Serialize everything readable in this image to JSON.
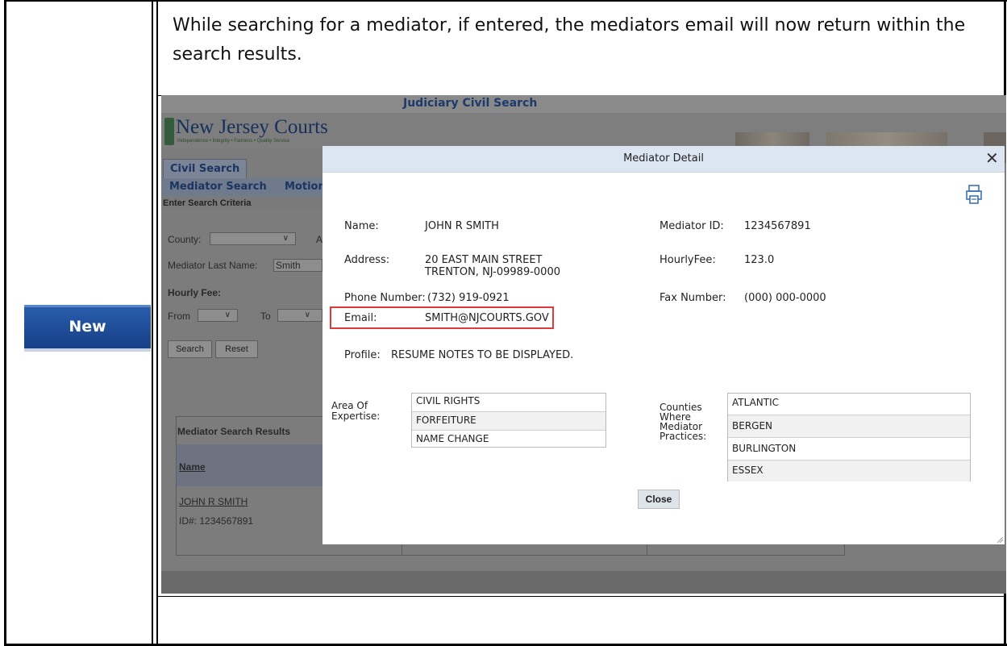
{
  "badge": "New",
  "description": "While searching for a mediator, if entered, the mediators email will now return within the search results.",
  "app": {
    "title": "Judiciary Civil Search",
    "logo_text": "New Jersey Courts",
    "logo_tagline": "Independence • Integrity • Fairness • Quality Service",
    "tab_civil": "Civil Search",
    "subtab_mediator": "Mediator Search",
    "subtab_motion": "Motion",
    "criteria_header": "Enter Search Criteria",
    "county_label": "County:",
    "county_value": "",
    "county_next_label": "A",
    "last_name_label": "Mediator Last Name:",
    "last_name_value": "Smith",
    "hourly_fee_label": "Hourly Fee:",
    "from_label": "From",
    "to_label": "To",
    "search_button": "Search",
    "reset_button": "Reset",
    "results_header": "Mediator Search Results",
    "name_column": "Name",
    "result_name": "JOHN R SMITH",
    "result_id": "ID#:  1234567891"
  },
  "modal": {
    "title": "Mediator Detail",
    "name_label": "Name:",
    "name_value": "JOHN R SMITH",
    "mediator_id_label": "Mediator ID:",
    "mediator_id_value": "1234567891",
    "address_label": "Address:",
    "address_line1": "20 EAST MAIN STREET",
    "address_line2": "TRENTON, NJ-09989-0000",
    "hourly_fee_label": "HourlyFee:",
    "hourly_fee_value": "123.0",
    "phone_label": "Phone Number:",
    "phone_value": "(732) 919-0921",
    "fax_label": "Fax Number:",
    "fax_value": "(000) 000-0000",
    "email_label": "Email:",
    "email_value": "SMITH@NJCOURTS.GOV",
    "profile_label": "Profile:",
    "profile_value": "RESUME NOTES TO BE DISPLAYED.",
    "expertise_label": "Area Of Expertise:",
    "expertise": [
      "CIVIL RIGHTS",
      "FORFEITURE",
      "NAME CHANGE"
    ],
    "counties_label": "Counties Where Mediator Practices:",
    "counties": [
      "ATLANTIC",
      "BERGEN",
      "BURLINGTON",
      "ESSEX"
    ],
    "close_button": "Close"
  }
}
